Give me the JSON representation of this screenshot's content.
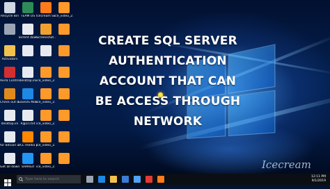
{
  "desktop": {
    "icons": [
      {
        "label": "Recycle Bin",
        "color": "#cfd8e3",
        "icon": "recycle-bin-icon"
      },
      {
        "label": "TEAM OS",
        "color": "#2e8b57",
        "icon": "folder-icon"
      },
      {
        "label": "Icecream Screen ...",
        "color": "#ff7a1a",
        "icon": "icecream-icon"
      },
      {
        "label": "ice_video_2...",
        "color": "#ff9a2a",
        "icon": "video-file-icon"
      },
      {
        "label": "",
        "color": "#9aa4b5",
        "icon": "file-icon"
      },
      {
        "label": "Torrent downloads",
        "color": "#e6eaf0",
        "icon": "file-icon"
      },
      {
        "label": "Screenshot...",
        "color": "#f0a030",
        "icon": "image-file-icon"
      },
      {
        "label": "",
        "color": "#ff9a2a",
        "icon": "video-file-icon"
      },
      {
        "label": "Activators",
        "color": "#f2c14e",
        "icon": "folder-icon"
      },
      {
        "label": "",
        "color": "#e6eaf0",
        "icon": "file-icon"
      },
      {
        "label": "",
        "color": "#e6eaf0",
        "icon": "file-icon"
      },
      {
        "label": "",
        "color": "#ff9a2a",
        "icon": "video-file-icon"
      },
      {
        "label": "Avira Control Center",
        "color": "#d32f2f",
        "icon": "avira-icon"
      },
      {
        "label": "desktop.ini",
        "color": "#e6eaf0",
        "icon": "ini-file-icon"
      },
      {
        "label": "ice_video_2...",
        "color": "#ff9a2a",
        "icon": "video-file-icon"
      },
      {
        "label": "",
        "color": "#ff9a2a",
        "icon": "video-file-icon"
      },
      {
        "label": "Check out our Stuff",
        "color": "#e08a1e",
        "icon": "shortcut-icon"
      },
      {
        "label": "EaseUS MobiSaver",
        "color": "#1e88e5",
        "icon": "easeus-icon"
      },
      {
        "label": "ice_video_2...",
        "color": "#ff9a2a",
        "icon": "video-file-icon"
      },
      {
        "label": "",
        "color": "#ff9a2a",
        "icon": "video-file-icon"
      },
      {
        "label": "desktop.ini",
        "color": "#e6eaf0",
        "icon": "ini-file-icon"
      },
      {
        "label": "R@1n.txt",
        "color": "#e6eaf0",
        "icon": "text-file-icon"
      },
      {
        "label": "ice_video_2...",
        "color": "#ff9a2a",
        "icon": "video-file-icon"
      },
      {
        "label": "",
        "color": "#ff9a2a",
        "icon": "video-file-icon"
      },
      {
        "label": "for Bitcoin users.txt",
        "color": "#e6eaf0",
        "icon": "text-file-icon"
      },
      {
        "label": "VLC media player",
        "color": "#ff8800",
        "icon": "vlc-icon"
      },
      {
        "label": "ice_video_2...",
        "color": "#ff9a2a",
        "icon": "video-file-icon"
      },
      {
        "label": "",
        "color": "#ff9a2a",
        "icon": "video-file-icon"
      },
      {
        "label": "Get all downloads...",
        "color": "#e6eaf0",
        "icon": "file-icon"
      },
      {
        "label": "SHAREit",
        "color": "#2196f3",
        "icon": "shareit-icon"
      },
      {
        "label": "ice_video_2...",
        "color": "#ff9a2a",
        "icon": "video-file-icon"
      },
      {
        "label": "",
        "color": "#ff9a2a",
        "icon": "video-file-icon"
      }
    ]
  },
  "headline": {
    "line1": "CREATE SQL SERVER",
    "line2": "AUTHENTICATION",
    "line3": "ACCOUNT THAT CAN",
    "line4": "BE ACCESS THROUGH",
    "line5": "NETWORK"
  },
  "taskbar": {
    "search_placeholder": "Type here to search",
    "clock_time": "12:11 PM",
    "clock_date": "9/1/2019",
    "pinned": [
      {
        "icon": "task-view-icon",
        "color": "#9aa4b5"
      },
      {
        "icon": "edge-icon",
        "color": "#1e88e5"
      },
      {
        "icon": "file-explorer-icon",
        "color": "#f2c14e"
      },
      {
        "icon": "store-icon",
        "color": "#3a7bd5"
      },
      {
        "icon": "mail-icon",
        "color": "#4fa3f7"
      },
      {
        "icon": "chrome-icon",
        "color": "#e53935"
      },
      {
        "icon": "icecream-icon",
        "color": "#ff7a1a"
      }
    ]
  },
  "watermark": {
    "text": "Icecream"
  }
}
